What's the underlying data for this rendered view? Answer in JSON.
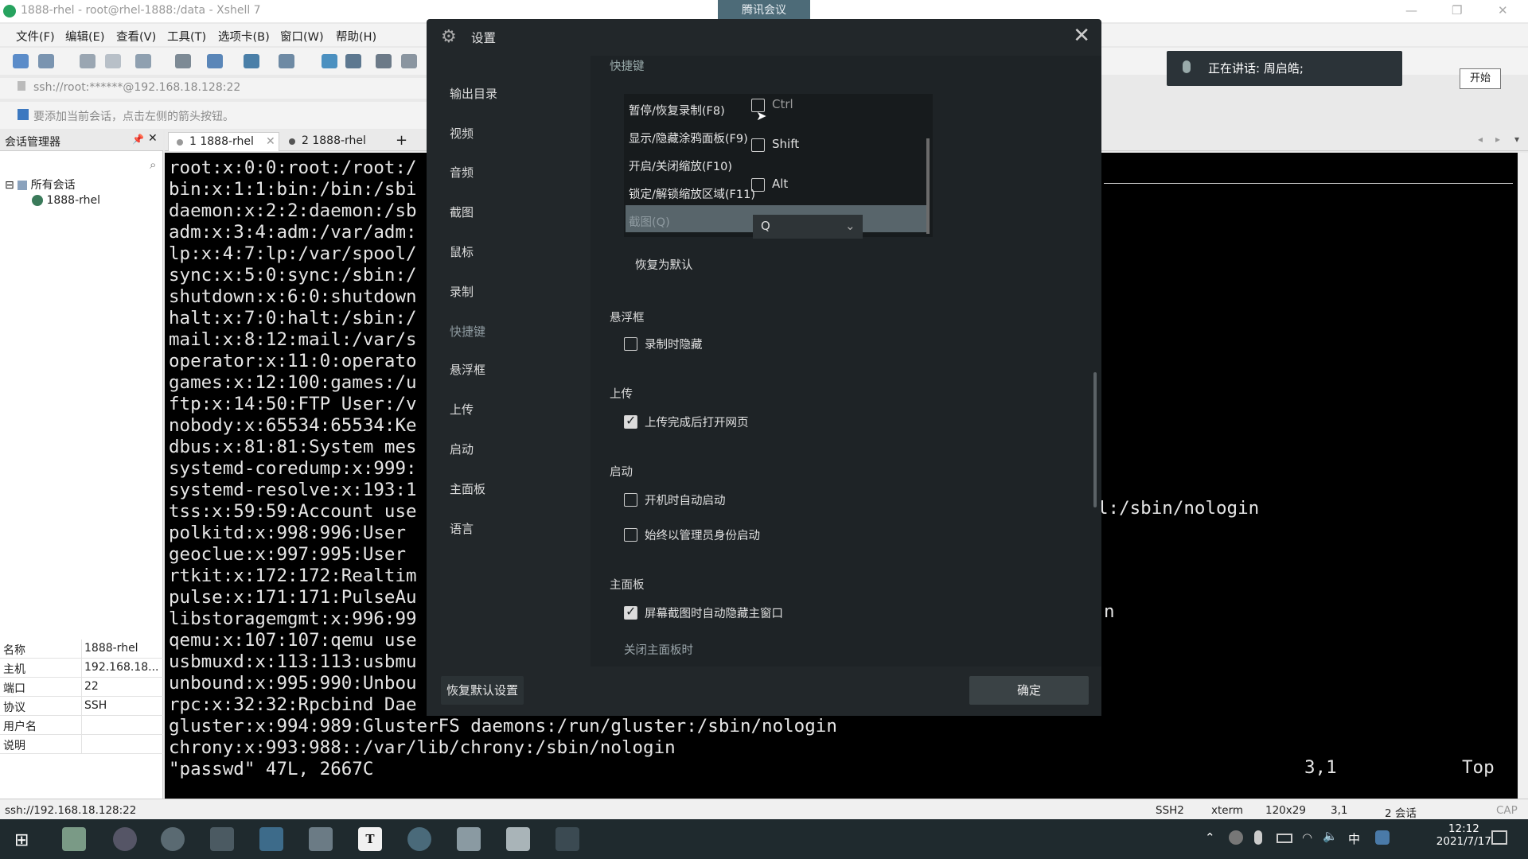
{
  "window": {
    "title": "1888-rhel - root@rhel-1888:/data - Xshell 7",
    "meeting_tab": "腾讯会议",
    "controls": [
      "—",
      "❐",
      "✕"
    ]
  },
  "menu": [
    "文件(F)",
    "编辑(E)",
    "查看(V)",
    "工具(T)",
    "选项卡(B)",
    "窗口(W)",
    "帮助(H)"
  ],
  "address": "ssh://root:******@192.168.18.128:22",
  "tip": "要添加当前会话，点击左侧的箭头按钮。",
  "session_manager": {
    "title": "会话管理器",
    "tree_root": "所有会话",
    "tree_child": "1888-rhel",
    "props": [
      {
        "k": "名称",
        "v": "1888-rhel"
      },
      {
        "k": "主机",
        "v": "192.168.18..."
      },
      {
        "k": "端口",
        "v": "22"
      },
      {
        "k": "协议",
        "v": "SSH"
      },
      {
        "k": "用户名",
        "v": ""
      },
      {
        "k": "说明",
        "v": ""
      }
    ]
  },
  "tabs": [
    {
      "label": "1 1888-rhel"
    },
    {
      "label": "2 1888-rhel"
    }
  ],
  "terminal": {
    "lines": [
      "root:x:0:0:root:/root:/",
      "bin:x:1:1:bin:/bin:/sbi",
      "daemon:x:2:2:daemon:/sb",
      "adm:x:3:4:adm:/var/adm:",
      "lp:x:4:7:lp:/var/spool/",
      "sync:x:5:0:sync:/sbin:/",
      "shutdown:x:6:0:shutdown",
      "halt:x:7:0:halt:/sbin:/",
      "mail:x:8:12:mail:/var/s",
      "operator:x:11:0:operato",
      "games:x:12:100:games:/u",
      "ftp:x:14:50:FTP User:/v",
      "nobody:x:65534:65534:Ke",
      "dbus:x:81:81:System mes",
      "systemd-coredump:x:999:",
      "systemd-resolve:x:193:1",
      "tss:x:59:59:Account use",
      "polkitd:x:998:996:User",
      "geoclue:x:997:995:User",
      "rtkit:x:172:172:Realtim",
      "pulse:x:171:171:PulseAu",
      "libstoragemgmt:x:996:99",
      "qemu:x:107:107:qemu use",
      "usbmuxd:x:113:113:usbmu",
      "unbound:x:995:990:Unbou",
      "rpc:x:32:32:Rpcbind Dae",
      "gluster:x:994:989:GlusterFS daemons:/run/gluster:/sbin/nologin",
      "chrony:x:993:988::/var/lib/chrony:/sbin/nologin",
      "\"passwd\" 47L, 2667C"
    ],
    "right_fragment_1": "l:/sbin/nologin",
    "right_fragment_2": "n",
    "position": "3,1",
    "top": "Top"
  },
  "statusbar": {
    "left": "ssh://192.168.18.128:22",
    "ssh": "SSH2",
    "term": "xterm",
    "size": "120x29",
    "pos": "3,1",
    "sessions": "2 会话",
    "caps": "CAP"
  },
  "meeting": {
    "speaking": "正在讲话: 周启皓;",
    "start": "开始"
  },
  "dialog": {
    "title": "设置",
    "nav": [
      "输出目录",
      "视频",
      "音频",
      "截图",
      "鼠标",
      "录制",
      "快捷键",
      "悬浮框",
      "上传",
      "启动",
      "主面板",
      "语言"
    ],
    "active_nav": "快捷键",
    "shortcut_header": "快捷键",
    "shortcuts": [
      "暂停/恢复录制(F8)",
      "显示/隐藏涂鸦面板(F9)",
      "开启/关闭缩放(F10)",
      "锁定/解锁缩放区域(F11)",
      "截图(Q)"
    ],
    "modifiers": [
      {
        "label": "Ctrl",
        "checked": false
      },
      {
        "label": "Shift",
        "checked": false
      },
      {
        "label": "Alt",
        "checked": false
      }
    ],
    "key_value": "Q",
    "restore_default": "恢复为默认",
    "sections": {
      "float": {
        "title": "悬浮框",
        "items": [
          {
            "label": "录制时隐藏",
            "checked": false
          }
        ]
      },
      "upload": {
        "title": "上传",
        "items": [
          {
            "label": "上传完成后打开网页",
            "checked": true
          }
        ]
      },
      "startup": {
        "title": "启动",
        "items": [
          {
            "label": "开机时自动启动",
            "checked": false
          },
          {
            "label": "始终以管理员身份启动",
            "checked": false
          }
        ]
      },
      "main": {
        "title": "主面板",
        "items": [
          {
            "label": "屏幕截图时自动隐藏主窗口",
            "checked": true
          }
        ],
        "sub": "关闭主面板时"
      }
    },
    "footer": {
      "restore_all": "恢复默认设置",
      "ok": "确定"
    }
  },
  "taskbar": {
    "time": "12:12",
    "date": "2021/7/17",
    "ime": "中"
  }
}
